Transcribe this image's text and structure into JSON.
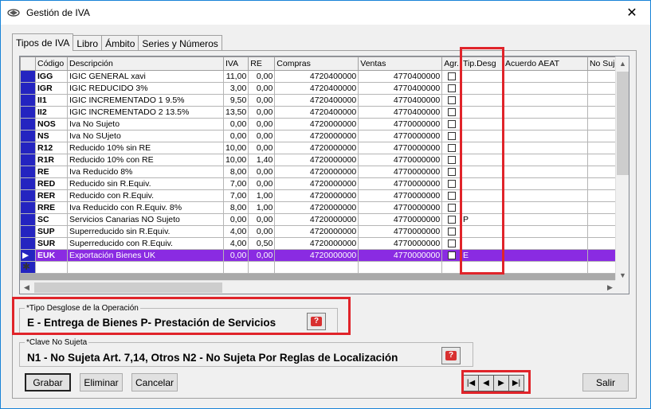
{
  "window": {
    "title": "Gestión de IVA",
    "close": "✕"
  },
  "tabs": [
    {
      "label": "Tipos de IVA"
    },
    {
      "label": "Libro"
    },
    {
      "label": "Ámbito"
    },
    {
      "label": "Series y Números"
    }
  ],
  "grid": {
    "columns": [
      "Código",
      "Descripción",
      "IVA",
      "RE",
      "Compras",
      "Ventas",
      "Agr.",
      "Tip.Desg",
      "Acuerdo AEAT",
      "No Suj."
    ],
    "rows": [
      {
        "code": "IGG",
        "desc": "IGIC GENERAL xavi",
        "iva": "11,00",
        "re": "0,00",
        "compras": "4720400000",
        "ventas": "4770400000",
        "tip": ""
      },
      {
        "code": "IGR",
        "desc": "IGIC REDUCIDO 3%",
        "iva": "3,00",
        "re": "0,00",
        "compras": "4720400000",
        "ventas": "4770400000",
        "tip": ""
      },
      {
        "code": "II1",
        "desc": "IGIC INCREMENTADO 1 9.5%",
        "iva": "9,50",
        "re": "0,00",
        "compras": "4720400000",
        "ventas": "4770400000",
        "tip": ""
      },
      {
        "code": "II2",
        "desc": "IGIC INCREMENTADO 2 13.5%",
        "iva": "13,50",
        "re": "0,00",
        "compras": "4720400000",
        "ventas": "4770400000",
        "tip": ""
      },
      {
        "code": "NOS",
        "desc": "Iva No Sujeto",
        "iva": "0,00",
        "re": "0,00",
        "compras": "4720000000",
        "ventas": "4770000000",
        "tip": ""
      },
      {
        "code": "NS",
        "desc": "Iva No SUjeto",
        "iva": "0,00",
        "re": "0,00",
        "compras": "4720000000",
        "ventas": "4770000000",
        "tip": ""
      },
      {
        "code": "R12",
        "desc": "Reducido 10% sin RE",
        "iva": "10,00",
        "re": "0,00",
        "compras": "4720000000",
        "ventas": "4770000000",
        "tip": ""
      },
      {
        "code": "R1R",
        "desc": "Reducido 10% con RE",
        "iva": "10,00",
        "re": "1,40",
        "compras": "4720000000",
        "ventas": "4770000000",
        "tip": ""
      },
      {
        "code": "RE",
        "desc": "Iva Reducido 8%",
        "iva": "8,00",
        "re": "0,00",
        "compras": "4720000000",
        "ventas": "4770000000",
        "tip": ""
      },
      {
        "code": "RED",
        "desc": "Reducido sin R.Equiv.",
        "iva": "7,00",
        "re": "0,00",
        "compras": "4720000000",
        "ventas": "4770000000",
        "tip": ""
      },
      {
        "code": "RER",
        "desc": "Reducido con R.Equiv.",
        "iva": "7,00",
        "re": "1,00",
        "compras": "4720000000",
        "ventas": "4770000000",
        "tip": ""
      },
      {
        "code": "RRE",
        "desc": "Iva Reducido con R.Equiv. 8%",
        "iva": "8,00",
        "re": "1,00",
        "compras": "4720000000",
        "ventas": "4770000000",
        "tip": ""
      },
      {
        "code": "SC",
        "desc": "Servicios Canarias NO Sujeto",
        "iva": "0,00",
        "re": "0,00",
        "compras": "4720000000",
        "ventas": "4770000000",
        "tip": "P"
      },
      {
        "code": "SUP",
        "desc": "Superreducido sin R.Equiv.",
        "iva": "4,00",
        "re": "0,00",
        "compras": "4720000000",
        "ventas": "4770000000",
        "tip": ""
      },
      {
        "code": "SUR",
        "desc": "Superreducido con R.Equiv.",
        "iva": "4,00",
        "re": "0,50",
        "compras": "4720000000",
        "ventas": "4770000000",
        "tip": ""
      },
      {
        "code": "EUK",
        "desc": "Exportación Bienes UK",
        "iva": "0,00",
        "re": "0,00",
        "compras": "4720000000",
        "ventas": "4770000000",
        "tip": "E"
      }
    ],
    "current_row_marker": "▶",
    "new_row_marker": "✱"
  },
  "desglose": {
    "legend": "*Tipo Desglose de la Operación",
    "text": "E - Entrega de Bienes  P- Prestación de Servicios"
  },
  "nosujeta": {
    "legend": "*Clave No Sujeta",
    "text": "N1 - No Sujeta Art. 7,14, Otros   N2 - No Sujeta Por Reglas de Localización"
  },
  "help_label": "?",
  "buttons": {
    "grabar": "Grabar",
    "eliminar": "Eliminar",
    "cancelar": "Cancelar",
    "salir": "Salir"
  },
  "nav": [
    "|◀",
    "◀",
    "▶",
    "▶|"
  ]
}
